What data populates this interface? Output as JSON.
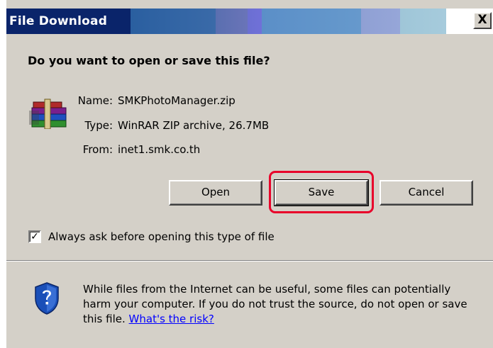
{
  "window": {
    "title": "File Download",
    "close_glyph": "X"
  },
  "dialog": {
    "question": "Do you want to open or save this file?",
    "file_icon": "winrar-archive-icon",
    "info": {
      "name_label": "Name:",
      "name_value": "SMKPhotoManager.zip",
      "type_label": "Type:",
      "type_value": "WinRAR ZIP archive, 26.7MB",
      "from_label": "From:",
      "from_value": "inet1.smk.co.th"
    },
    "buttons": {
      "open": "Open",
      "save": "Save",
      "cancel": "Cancel"
    },
    "checkbox": {
      "checked": true,
      "glyph": "✓",
      "label": "Always ask before opening this type of file"
    },
    "warning": {
      "icon": "security-shield-icon",
      "text": "While files from the Internet can be useful, some files can potentially harm your computer. If you do not trust the source, do not open or save this file.",
      "link": "What's the risk?"
    },
    "annotation": {
      "highlight_color": "#e8002a",
      "target": "save-button"
    }
  }
}
